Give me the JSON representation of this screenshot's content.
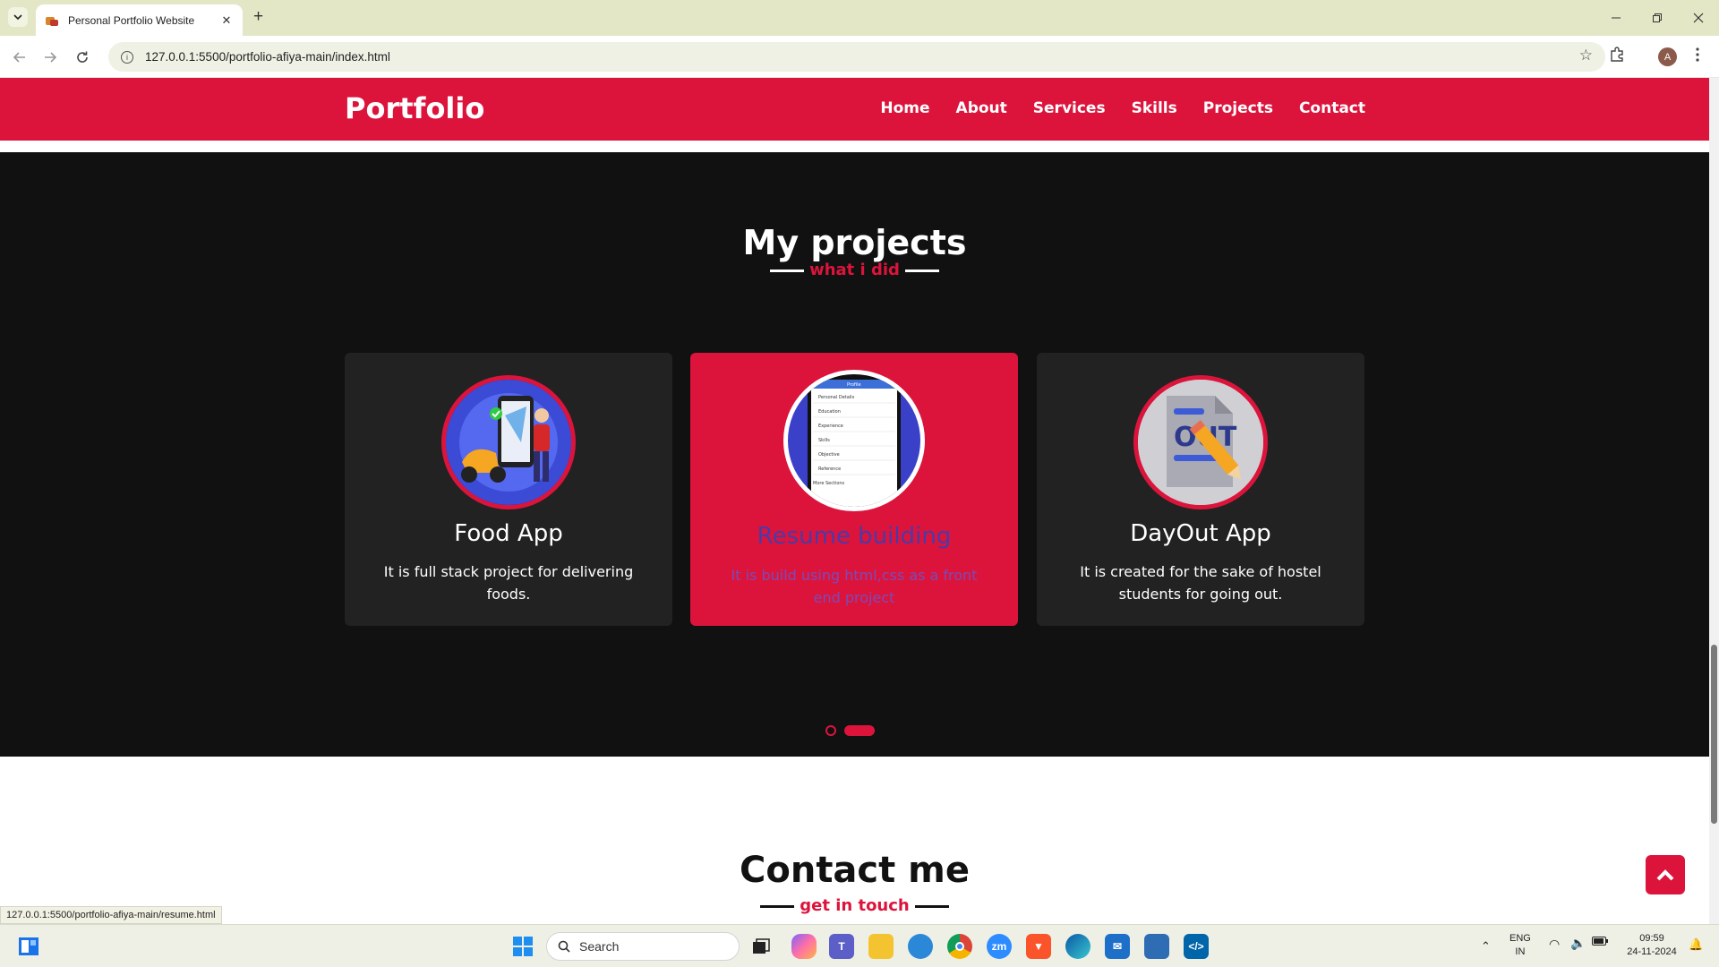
{
  "browser": {
    "tab_title": "Personal Portfolio Website",
    "tab_close": "✕",
    "new_tab": "+",
    "url": "127.0.0.1:5500/portfolio-afiya-main/index.html",
    "profile_initial": "A",
    "status_url": "127.0.0.1:5500/portfolio-afiya-main/resume.html"
  },
  "site": {
    "logo": "Portfolio",
    "menu": [
      "Home",
      "About",
      "Services",
      "Skills",
      "Projects",
      "Contact"
    ]
  },
  "projects": {
    "title": "My projects",
    "subtitle": "what i did",
    "cards": [
      {
        "title": "Food App",
        "desc": "It is full stack project for delivering foods.",
        "active": false,
        "icon": "food-app-image"
      },
      {
        "title": "Resume building",
        "desc": "It is build using html,css as a front end project",
        "active": true,
        "icon": "resume-app-image"
      },
      {
        "title": "DayOut App",
        "desc": "It is created for the sake of hostel students for going out.",
        "active": false,
        "icon": "dayout-app-image"
      }
    ],
    "resume_menu": [
      "Profile",
      "Personal Details",
      "Education",
      "Experience",
      "Skills",
      "Objective",
      "Reference",
      "More Sections"
    ],
    "dayout_badge": "OUT"
  },
  "contact": {
    "title": "Contact me",
    "subtitle": "get in touch"
  },
  "taskbar": {
    "search_placeholder": "Search",
    "lang_top": "ENG",
    "lang_bottom": "IN",
    "time": "09:59",
    "date": "24-11-2024",
    "zoom_label": "zm"
  },
  "colors": {
    "accent": "#dc143c",
    "dark_section": "#111111",
    "card": "#222222"
  }
}
